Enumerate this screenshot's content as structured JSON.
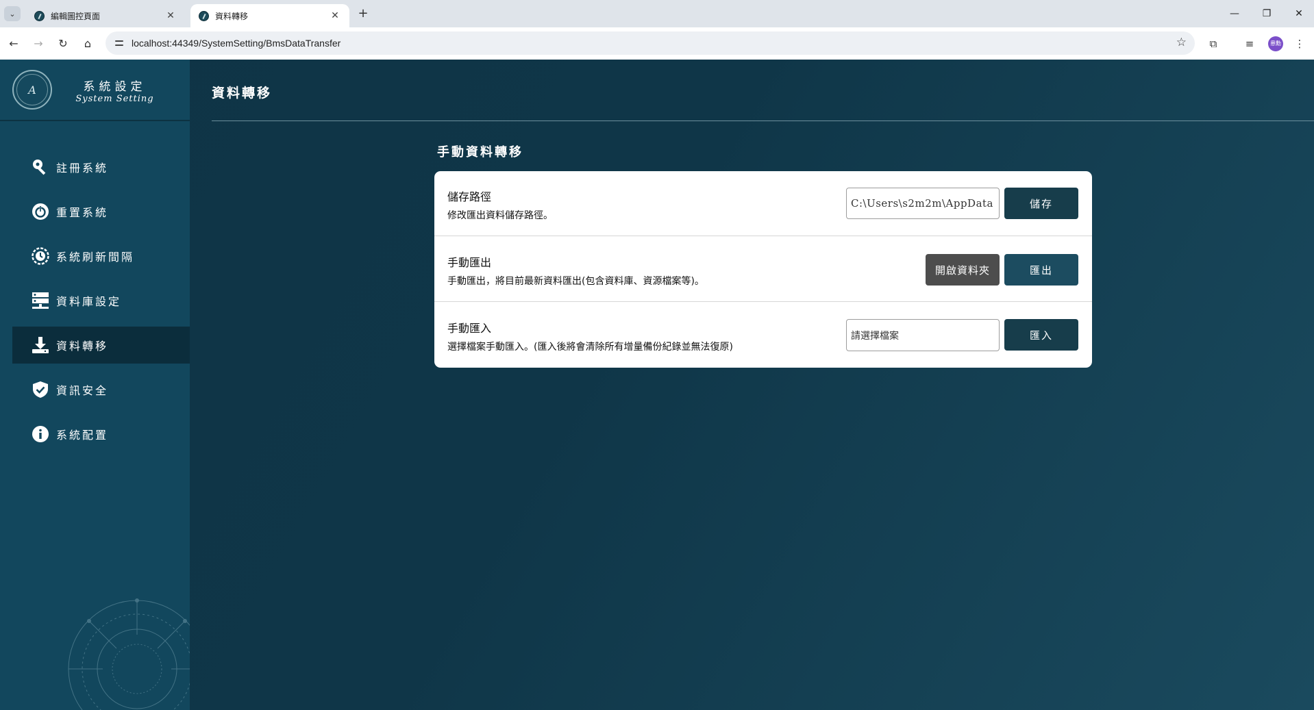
{
  "browser": {
    "tabs": [
      {
        "title": "編輯圖控頁面",
        "active": false
      },
      {
        "title": "資料轉移",
        "active": true
      }
    ],
    "url": "localhost:44349/SystemSetting/BmsDataTransfer",
    "profile_label": "患勳"
  },
  "sidebar": {
    "brand_title": "系統設定",
    "brand_subtitle": "System Setting",
    "logo_text": "A",
    "items": [
      {
        "label": "註冊系統",
        "icon": "key-icon",
        "active": false
      },
      {
        "label": "重置系統",
        "icon": "power-icon",
        "active": false
      },
      {
        "label": "系統刷新間隔",
        "icon": "refresh-interval-icon",
        "active": false
      },
      {
        "label": "資料庫設定",
        "icon": "server-icon",
        "active": false
      },
      {
        "label": "資料轉移",
        "icon": "download-icon",
        "active": true
      },
      {
        "label": "資訊安全",
        "icon": "shield-icon",
        "active": false
      },
      {
        "label": "系統配置",
        "icon": "info-icon",
        "active": false
      }
    ]
  },
  "main": {
    "page_title": "資料轉移",
    "section_title": "手動資料轉移",
    "rows": {
      "storage": {
        "title": "儲存路徑",
        "description": "修改匯出資料儲存路徑。",
        "path_value": "C:\\Users\\s2m2m\\AppData",
        "save_label": "儲存"
      },
      "export": {
        "title": "手動匯出",
        "description": "手動匯出，將目前最新資料匯出(包含資料庫、資源檔案等)。",
        "open_folder_label": "開啟資料夾",
        "export_label": "匯出"
      },
      "import": {
        "title": "手動匯入",
        "description": "選擇檔案手動匯入。(匯入後將會清除所有增量備份紀錄並無法復原)",
        "file_placeholder": "請選擇檔案",
        "import_label": "匯入"
      }
    }
  },
  "colors": {
    "sidebar": "#12475d",
    "sidebar_active": "#0b2d3c",
    "primary_button": "#173d4b",
    "secondary_button": "#4d4d4d"
  }
}
